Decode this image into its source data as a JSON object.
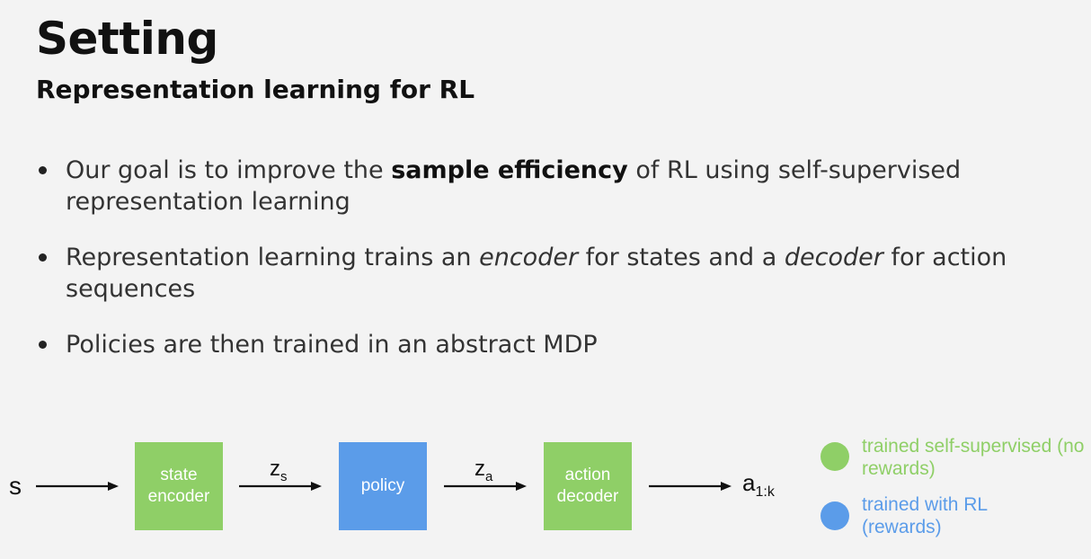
{
  "slide": {
    "title": "Setting",
    "subtitle": "Representation learning for RL"
  },
  "bullets": [
    {
      "pre": "Our goal is to improve the ",
      "bold": "sample efficiency",
      "post": " of RL using self-supervised representation learning"
    },
    {
      "pre": "Representation learning trains an ",
      "em1": "encoder",
      "mid": " for states and a ",
      "em2": "decoder",
      "post": " for action sequences"
    },
    {
      "text": "Policies are then trained in an abstract MDP"
    }
  ],
  "diagram": {
    "input": "s",
    "state_encoder": "state encoder",
    "zs_base": "z",
    "zs_sub": "s",
    "policy": "policy",
    "za_base": "z",
    "za_sub": "a",
    "action_decoder": "action decoder",
    "output_base": "a",
    "output_sub": "1:k"
  },
  "legend": {
    "green_label": "trained self-supervised (no rewards)",
    "blue_label": "trained with RL (rewards)",
    "green_color": "#8fcf67",
    "blue_color": "#5b9ce9"
  }
}
